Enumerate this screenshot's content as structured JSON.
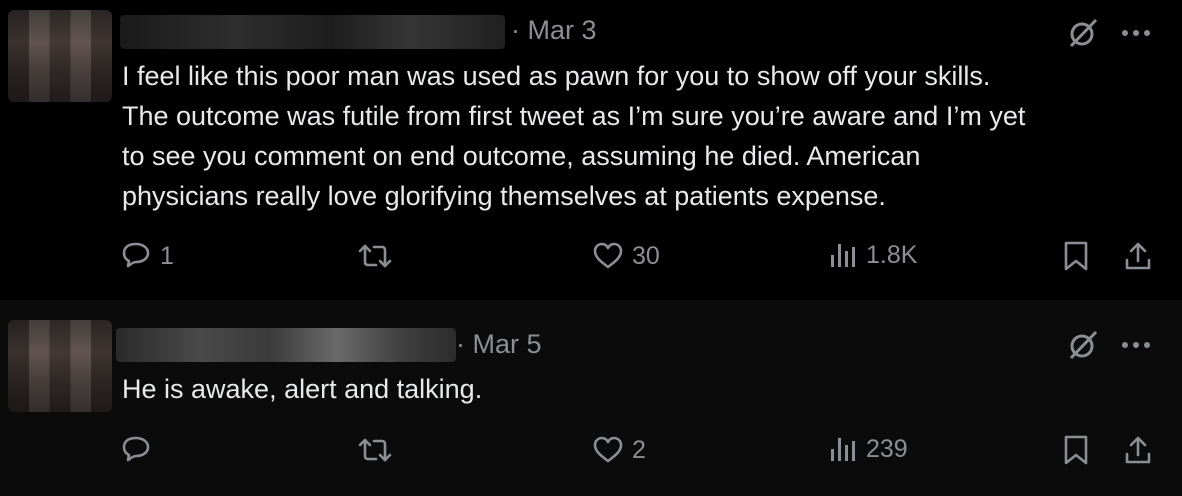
{
  "tweets": [
    {
      "date": "· Mar 3",
      "lines": [
        "I feel like this poor man was used as pawn for you to show off your skills.",
        "The outcome was futile from first tweet as I’m sure you’re aware and I’m yet",
        "to see you comment on end outcome, assuming he died. American",
        "physicians really love glorifying themselves at patients expense."
      ],
      "replies": "1",
      "retweets": "",
      "likes": "30",
      "views": "1.8K"
    },
    {
      "date": "· Mar 5",
      "lines": [
        "He is awake, alert and talking."
      ],
      "replies": "",
      "retweets": "",
      "likes": "2",
      "views": "239"
    }
  ],
  "icons": {
    "reply": "reply-icon",
    "retweet": "retweet-icon",
    "like": "heart-icon",
    "views": "views-icon",
    "bookmark": "bookmark-icon",
    "share": "share-icon",
    "grok": "grok-icon",
    "more": "more-icon"
  },
  "colors": {
    "background": "#000000",
    "text": "#e7e9ea",
    "muted": "#8b8f94"
  }
}
